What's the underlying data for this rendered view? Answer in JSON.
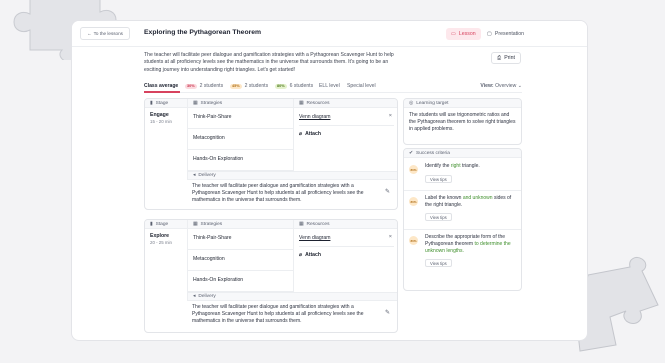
{
  "header": {
    "back_label": "To the lessons",
    "title": "Exploring the Pythagorean Theorem",
    "tabs": [
      {
        "label": "Lesson",
        "active": true
      },
      {
        "label": "Presentation",
        "active": false
      }
    ]
  },
  "description": "The teacher will facilitate peer dialogue and gamification strategies with a Pythagorean Scavenger Hunt to help students at all proficiency levels see the mathematics in the universe that surrounds them. It's going to be an exciting journey into understanding right triangles. Let's get started!",
  "print_label": "Print",
  "levels": {
    "items": [
      {
        "label": "Class average",
        "pct": "",
        "active": true
      },
      {
        "label": "2 students",
        "pct": "30%",
        "tone": "p1"
      },
      {
        "label": "2 students",
        "pct": "45%",
        "tone": "p2"
      },
      {
        "label": "6 students",
        "pct": "80%",
        "tone": "p3"
      },
      {
        "label": "ELL level"
      },
      {
        "label": "Special level"
      }
    ],
    "view_label": "View:",
    "view_value": "Overview"
  },
  "columns": {
    "stage": "Stage",
    "strategies": "Strategies",
    "resources": "Resources",
    "delivery": "Delivery"
  },
  "stages": [
    {
      "name": "Engage",
      "time": "15 - 20 min",
      "strategies": [
        "Think-Pair-Share",
        "Metacognition",
        "Hands-On Exploration"
      ],
      "resource": "Venn diagram",
      "attach": "Attach",
      "delivery": "The teacher will facilitate peer dialogue and gamification strategies with a Pythagorean Scavenger Hunt to help students at all proficiency levels see the mathematics in the universe that surrounds them."
    },
    {
      "name": "Explore",
      "time": "20 - 25 min",
      "strategies": [
        "Think-Pair-Share",
        "Metacognition",
        "Hands-On Exploration"
      ],
      "resource": "Venn diagram",
      "attach": "Attach",
      "delivery": "The teacher will facilitate peer dialogue and gamification strategies with a Pythagorean Scavenger Hunt to help students at all proficiency levels see the mathematics in the universe that surrounds them."
    }
  ],
  "learning_target": {
    "title": "Learning target",
    "text": "The students will use trigonometric ratios and the Pythagorean theorem to solve right triangles in applied problems."
  },
  "success_criteria": {
    "title": "Success criteria",
    "view_tips": "View tips",
    "items": [
      {
        "pct": "80%",
        "pre": "Identify the ",
        "hl": "right",
        "post": " triangle."
      },
      {
        "pct": "80%",
        "pre": "Label the known ",
        "hl": "and unknown",
        "post": " sides of the right triangle."
      },
      {
        "pct": "80%",
        "pre": "Describe the appropriate form of the Pythagorean theorem ",
        "hl": "to determine the unknown lengths.",
        "post": ""
      }
    ]
  },
  "colors": {
    "accent": "#d7425e",
    "highlight": "#3f8f2c"
  }
}
